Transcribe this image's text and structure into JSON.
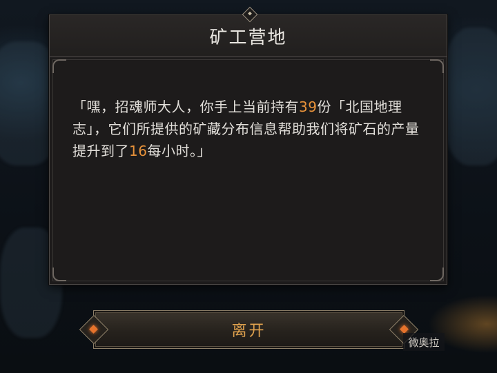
{
  "dialog": {
    "title": "矿工营地",
    "message_parts": [
      "「嘿，招魂师大人，你手上当前持有",
      "39",
      "份「北国地理志」，它们所提供的矿藏分布信息帮助我们将矿石的产量提升到了",
      "16",
      "每小时。」"
    ]
  },
  "buttons": {
    "leave_label": "离开"
  },
  "background": {
    "partial_label": "微奥拉"
  },
  "colors": {
    "highlight_number": "#e8923a",
    "button_text": "#e0a24e",
    "gem": "#e6732c"
  }
}
